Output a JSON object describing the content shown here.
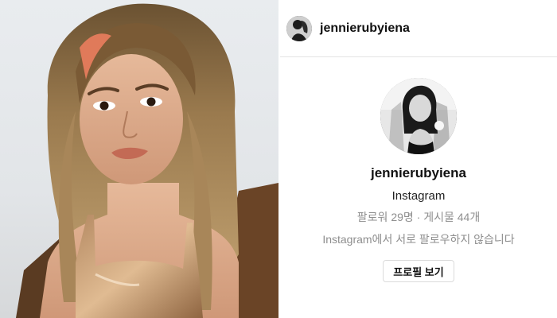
{
  "chat_header": {
    "username": "jennierubyiena"
  },
  "profile_card": {
    "username": "jennierubyiena",
    "platform": "Instagram",
    "stats": "팔로워 29명 · 게시물 44개",
    "follow_status": "Instagram에서 서로 팔로우하지 않습니다",
    "view_profile_label": "프로필 보기"
  }
}
